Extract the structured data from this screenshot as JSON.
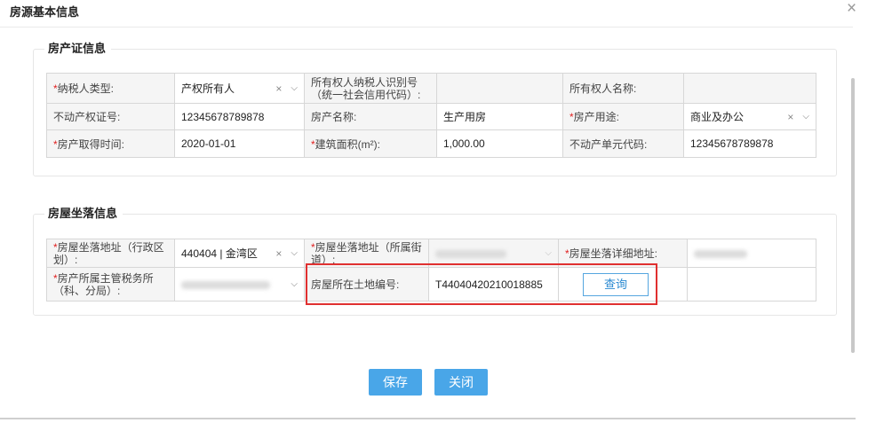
{
  "dialog": {
    "title": "房源基本信息",
    "close_glyph": "×"
  },
  "cert_section": {
    "title": "房产证信息",
    "rows": [
      [
        {
          "label": "纳税人类型:",
          "required": true
        },
        {
          "value": "产权所有人",
          "type": "select",
          "clear": "×",
          "chevron": "⌵"
        },
        {
          "label": "所有权人纳税人识别号（统一社会信用代码）:"
        },
        {
          "value": "",
          "type": "readonly"
        },
        {
          "label": "所有权人名称:"
        },
        {
          "value": "",
          "type": "readonly"
        }
      ],
      [
        {
          "label": "不动产权证号:"
        },
        {
          "value": "12345678789878"
        },
        {
          "label": "房产名称:"
        },
        {
          "value": "生产用房"
        },
        {
          "label": "房产用途:",
          "required": true
        },
        {
          "value": "商业及办公",
          "type": "select",
          "clear": "×",
          "chevron": "⌵"
        }
      ],
      [
        {
          "label": "房产取得时间:",
          "required": true
        },
        {
          "value": "2020-01-01"
        },
        {
          "label": "建筑面积(m²):",
          "required": true
        },
        {
          "value": "1,000.00"
        },
        {
          "label": "不动产单元代码:"
        },
        {
          "value": "12345678789878"
        }
      ]
    ]
  },
  "location_section": {
    "title": "房屋坐落信息",
    "row1": {
      "district_label": "房屋坐落地址（行政区划）:",
      "district_value": "440404 | 金湾区",
      "street_label": "房屋坐落地址（所属街道）:",
      "detail_label": "房屋坐落详细地址:"
    },
    "row2": {
      "tax_office_label": "房产所属主管税务所（科、分局）:",
      "land_no_label": "房屋所在土地编号:",
      "land_no_value": "T44040420210018885",
      "query_button": "查询"
    },
    "clear": "×",
    "chevron": "⌵"
  },
  "footer": {
    "save": "保存",
    "close": "关闭"
  },
  "colors": {
    "accent": "#49a6e8",
    "required": "#e02020",
    "highlight": "#e03030"
  }
}
